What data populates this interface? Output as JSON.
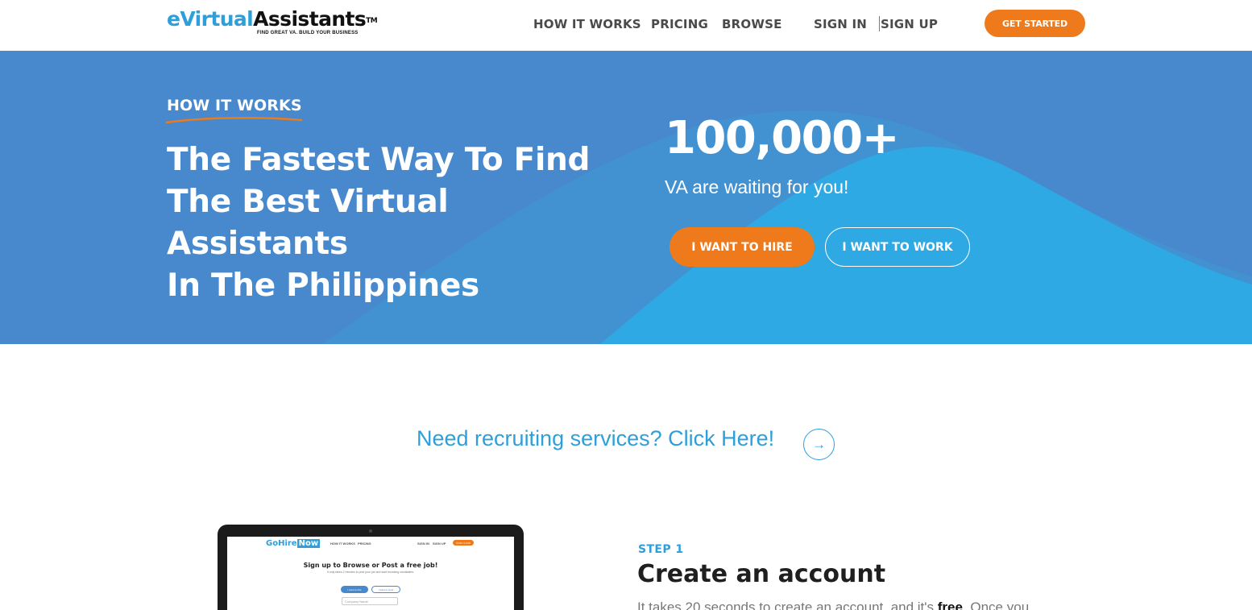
{
  "header": {
    "logo": {
      "part1": "eVirtual",
      "part2": "Assistants",
      "tm": "TM",
      "tagline": "FIND GREAT VA. BUILD YOUR BUSINESS"
    },
    "nav": [
      {
        "label": "HOW IT WORKS"
      },
      {
        "label": "PRICING"
      },
      {
        "label": "BROWSE"
      },
      {
        "label": "SIGN IN"
      },
      {
        "label": "SIGN UP"
      }
    ],
    "cta": "GET STARTED"
  },
  "hero": {
    "eyebrow": "HOW IT WORKS",
    "headline_lines": [
      "The Fastest Way To Find",
      "The Best Virtual Assistants",
      "In The Philippines"
    ],
    "stat": "100,000+",
    "stat_sub": "VA are waiting for you!",
    "hire_button": "I WANT TO HIRE",
    "work_button": "I WANT TO WORK"
  },
  "recruiting": {
    "text": "Need recruiting services? Click Here!",
    "icon": "arrow-right-icon"
  },
  "laptop_preview": {
    "logo_a": "GoHire",
    "logo_b": "Now",
    "nav": [
      "HOW IT WORKS",
      "PRICING",
      "SIGN IN",
      "SIGN UP"
    ],
    "cta": "POST A JOB",
    "title": "Sign up to Browse or Post a free job!",
    "subtitle": "It only takes 2 minutes to post your job and start browsing candidates.",
    "button1": "I want to hire",
    "button2": "I want to work",
    "field_placeholder": "Company Name"
  },
  "step1": {
    "label": "STEP 1",
    "title": "Create an account",
    "text_before": "It takes 20 seconds to create an account, and it's ",
    "text_bold": "free",
    "text_after": ". Once you"
  },
  "colors": {
    "brand_blue": "#2e9fd9",
    "hero_blue": "#4789cc",
    "hero_light": "#2ea9e3",
    "orange": "#ef7a1b"
  }
}
